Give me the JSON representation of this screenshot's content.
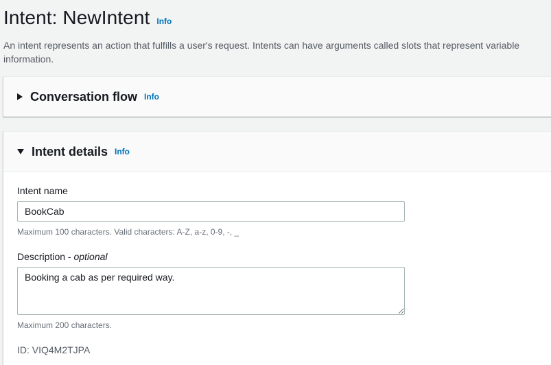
{
  "header": {
    "title": "Intent: NewIntent",
    "info": "Info",
    "description": "An intent represents an action that fulfills a user's request. Intents can have arguments called slots that represent variable information."
  },
  "conversation_flow": {
    "title": "Conversation flow",
    "info": "Info",
    "expanded": false
  },
  "intent_details": {
    "title": "Intent details",
    "info": "Info",
    "expanded": true,
    "name_label": "Intent name",
    "name_value": "BookCab",
    "name_constraint": "Maximum 100 characters. Valid characters: A-Z, a-z, 0-9, -, _",
    "description_label": "Description - ",
    "description_optional": "optional",
    "description_value": "Booking a cab as per required way.",
    "description_constraint": "Maximum 200 characters.",
    "id_text": "ID: VIQ4M2TJPA"
  }
}
